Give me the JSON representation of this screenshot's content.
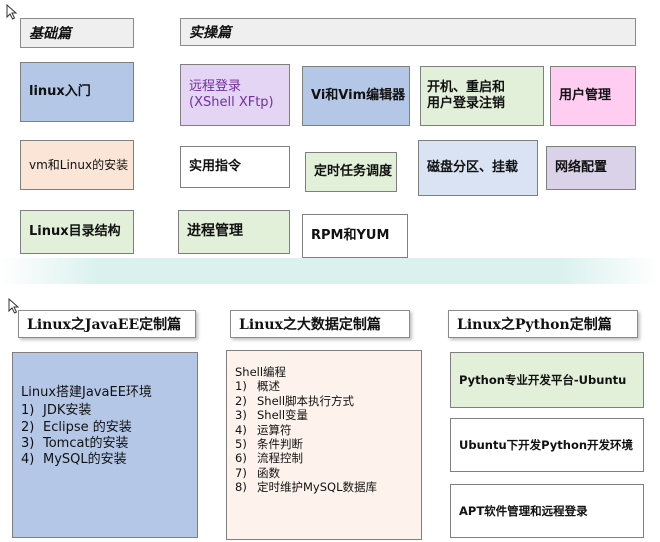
{
  "basic": {
    "header": "基础篇",
    "items": [
      "linux入门",
      "vm和Linux的安装",
      "Linux目录结构"
    ]
  },
  "practice": {
    "header": "实操篇",
    "row1": {
      "remote_line1": "远程登录",
      "remote_line2": "(XShell XFtp)",
      "editor": "Vi和Vim编辑器",
      "power_line1": "开机、重启和",
      "power_line2": "用户登录注销",
      "user_mgmt": "用户管理"
    },
    "row2": {
      "commands": "实用指令",
      "cron": "定时任务调度",
      "disk": "磁盘分区、挂载",
      "network": "网络配置"
    },
    "row3": {
      "process": "进程管理",
      "rpm": "RPM和YUM"
    }
  },
  "javaee": {
    "header": "Linux之JavaEE定制篇",
    "title": "Linux搭建JavaEE环境",
    "items": [
      {
        "n": "1)",
        "t": "JDK安装"
      },
      {
        "n": "2)",
        "t": "Eclipse 的安装"
      },
      {
        "n": "3)",
        "t": "Tomcat的安装"
      },
      {
        "n": "4)",
        "t": "MySQL的安装"
      }
    ]
  },
  "bigdata": {
    "header": "Linux之大数据定制篇",
    "title": "Shell编程",
    "items": [
      {
        "n": "1)",
        "t": "概述"
      },
      {
        "n": "2)",
        "t": "Shell脚本执行方式"
      },
      {
        "n": "3)",
        "t": "Shell变量"
      },
      {
        "n": "4)",
        "t": "运算符"
      },
      {
        "n": "5)",
        "t": "条件判断"
      },
      {
        "n": "6)",
        "t": "流程控制"
      },
      {
        "n": "7)",
        "t": "函数"
      },
      {
        "n": "8)",
        "t": "定时维护MySQL数据库"
      }
    ]
  },
  "python": {
    "header": "Linux之Python定制篇",
    "items": [
      "Python专业开发平台-Ubuntu",
      "Ubuntu下开发Python开发环境",
      "APT软件管理和远程登录"
    ]
  },
  "colors": {
    "blue": "#b4c7e7",
    "peach": "#fbe5d6",
    "green": "#e2f0d9",
    "purple": "#e4d5f5",
    "pink": "#ffccf2",
    "lavender": "#d9d2e9",
    "lightblue": "#dae3f3"
  }
}
